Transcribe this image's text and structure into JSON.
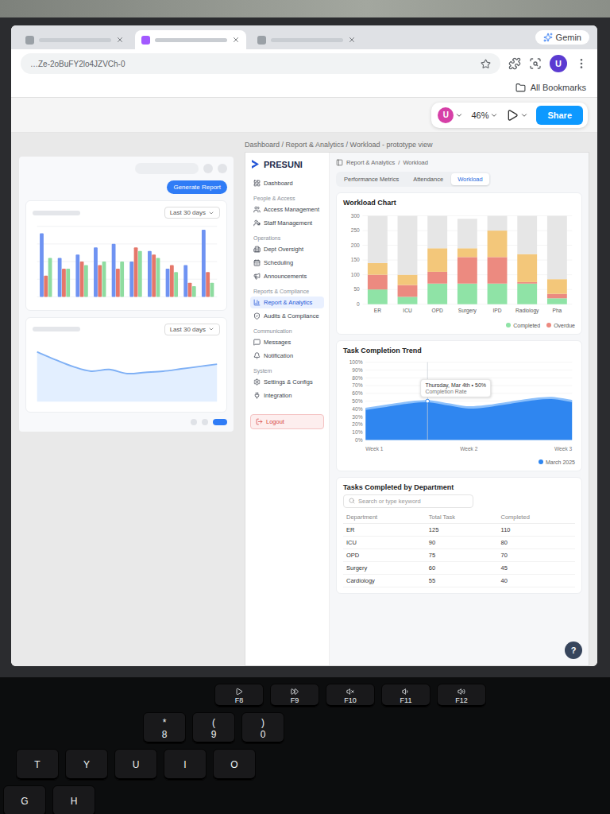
{
  "browser": {
    "tabs": [
      {
        "selected": false
      },
      {
        "selected": true
      },
      {
        "selected": false
      }
    ],
    "ai_button": "Gemin",
    "url": "…Ze-2oBuFY2lo4JZVCh-0",
    "profile": "U",
    "bookmarks": "All Bookmarks"
  },
  "toolbar": {
    "avatar": "U",
    "zoom": "46%",
    "share": "Share"
  },
  "left_frame": {
    "button": "Generate Report",
    "bar_filter": "Last 30 days",
    "line_filter": "Last 30 days",
    "series": [
      {
        "color": "#6f93f2",
        "values": [
          90,
          55,
          60,
          70,
          75,
          50,
          65,
          40,
          45,
          95
        ]
      },
      {
        "color": "#e5776a",
        "values": [
          30,
          40,
          50,
          45,
          40,
          70,
          60,
          45,
          20,
          35
        ]
      },
      {
        "color": "#8fdca0",
        "values": [
          55,
          40,
          45,
          50,
          50,
          65,
          55,
          35,
          15,
          20
        ]
      }
    ],
    "line_values": [
      85,
      72,
      60,
      52,
      55,
      48,
      50,
      52,
      56,
      60,
      64
    ]
  },
  "right_frame": {
    "caption": "Dashboard / Report & Analytics / Workload - prototype view",
    "logo": "PRESUNI",
    "sidebar": {
      "items": [
        {
          "kind": "item",
          "label": "Dashboard",
          "selected": false
        },
        {
          "kind": "section",
          "label": "People & Access"
        },
        {
          "kind": "item",
          "label": "Access Management",
          "selected": false
        },
        {
          "kind": "item",
          "label": "Staff Management",
          "selected": false
        },
        {
          "kind": "section",
          "label": "Operations"
        },
        {
          "kind": "item",
          "label": "Dept Oversight",
          "selected": false
        },
        {
          "kind": "item",
          "label": "Scheduling",
          "selected": false
        },
        {
          "kind": "item",
          "label": "Announcements",
          "selected": false
        },
        {
          "kind": "section",
          "label": "Reports & Compliance"
        },
        {
          "kind": "item",
          "label": "Report & Analytics",
          "selected": true
        },
        {
          "kind": "item",
          "label": "Audits & Compliance",
          "selected": false
        },
        {
          "kind": "section",
          "label": "Communication"
        },
        {
          "kind": "item",
          "label": "Messages",
          "selected": false
        },
        {
          "kind": "item",
          "label": "Notification",
          "selected": false
        },
        {
          "kind": "section",
          "label": "System"
        },
        {
          "kind": "item",
          "label": "Settings & Configs",
          "selected": false
        },
        {
          "kind": "item",
          "label": "Integration",
          "selected": false
        }
      ],
      "logout": "Logout"
    },
    "breadcrumb": {
      "items": [
        "Report & Analytics",
        "Workload"
      ],
      "separator": "/"
    },
    "tabs": [
      {
        "label": "Performance Metrics",
        "selected": false
      },
      {
        "label": "Attendance",
        "selected": false
      },
      {
        "label": "Workload",
        "selected": true
      }
    ],
    "workload_chart": {
      "title": "Workload Chart",
      "max": 300,
      "y_ticks": [
        "300",
        "250",
        "200",
        "150",
        "100",
        "50",
        "0"
      ],
      "categories": [
        "ER",
        "ICU",
        "OPD",
        "Surgery",
        "IPD",
        "Radiology",
        "Pha"
      ],
      "series": [
        {
          "color": "#8fe3a6",
          "values": [
            50,
            25,
            70,
            70,
            70,
            70,
            20
          ]
        },
        {
          "color": "#ec8a80",
          "values": [
            50,
            40,
            40,
            90,
            90,
            5,
            15
          ]
        },
        {
          "color": "#f3c77a",
          "values": [
            40,
            35,
            80,
            30,
            90,
            95,
            50
          ]
        },
        {
          "color": "#e6e6e6",
          "values": [
            160,
            200,
            110,
            100,
            50,
            130,
            215
          ]
        }
      ],
      "legend": [
        {
          "label": "Completed",
          "color": "#8fe3a6"
        },
        {
          "label": "Overdue",
          "color": "#ec8a80"
        }
      ]
    },
    "trend_chart": {
      "title": "Task Completion Trend",
      "y_ticks": [
        "100%",
        "90%",
        "80%",
        "70%",
        "60%",
        "50%",
        "40%",
        "30%",
        "20%",
        "10%",
        "0%"
      ],
      "values": [
        40,
        44,
        48,
        50,
        46,
        42,
        44,
        48,
        52,
        54,
        50
      ],
      "x_labels": [
        "Week 1",
        "Week 2",
        "Week 3"
      ],
      "tooltip": {
        "index": 3,
        "title": "Thursday, Mar 4th • 50%",
        "label": "Completion Rate"
      },
      "period": "March 2025"
    },
    "table": {
      "title": "Tasks Completed by Department",
      "search_placeholder": "Search or type keyword",
      "columns": [
        "Department",
        "Total Task",
        "Completed"
      ],
      "rows": [
        [
          "ER",
          "125",
          "110"
        ],
        [
          "ICU",
          "90",
          "80"
        ],
        [
          "OPD",
          "75",
          "70"
        ],
        [
          "Surgery",
          "60",
          "45"
        ],
        [
          "Cardiology",
          "55",
          "40"
        ]
      ]
    },
    "help": "?"
  },
  "keyboard": {
    "fn_keys": [
      {
        "label": "F8",
        "kind": "play"
      },
      {
        "label": "F9",
        "kind": "next"
      },
      {
        "label": "F10",
        "kind": "mute"
      },
      {
        "label": "F11",
        "kind": "down"
      },
      {
        "label": "F12",
        "kind": "up"
      }
    ],
    "number_keys": [
      {
        "shifted": "*",
        "label": "8"
      },
      {
        "shifted": "(",
        "label": "9"
      },
      {
        "shifted": ")",
        "label": "0"
      }
    ],
    "letter_rows": [
      [
        "T",
        "Y",
        "U",
        "I",
        "O"
      ],
      [
        "G",
        "H"
      ]
    ]
  }
}
